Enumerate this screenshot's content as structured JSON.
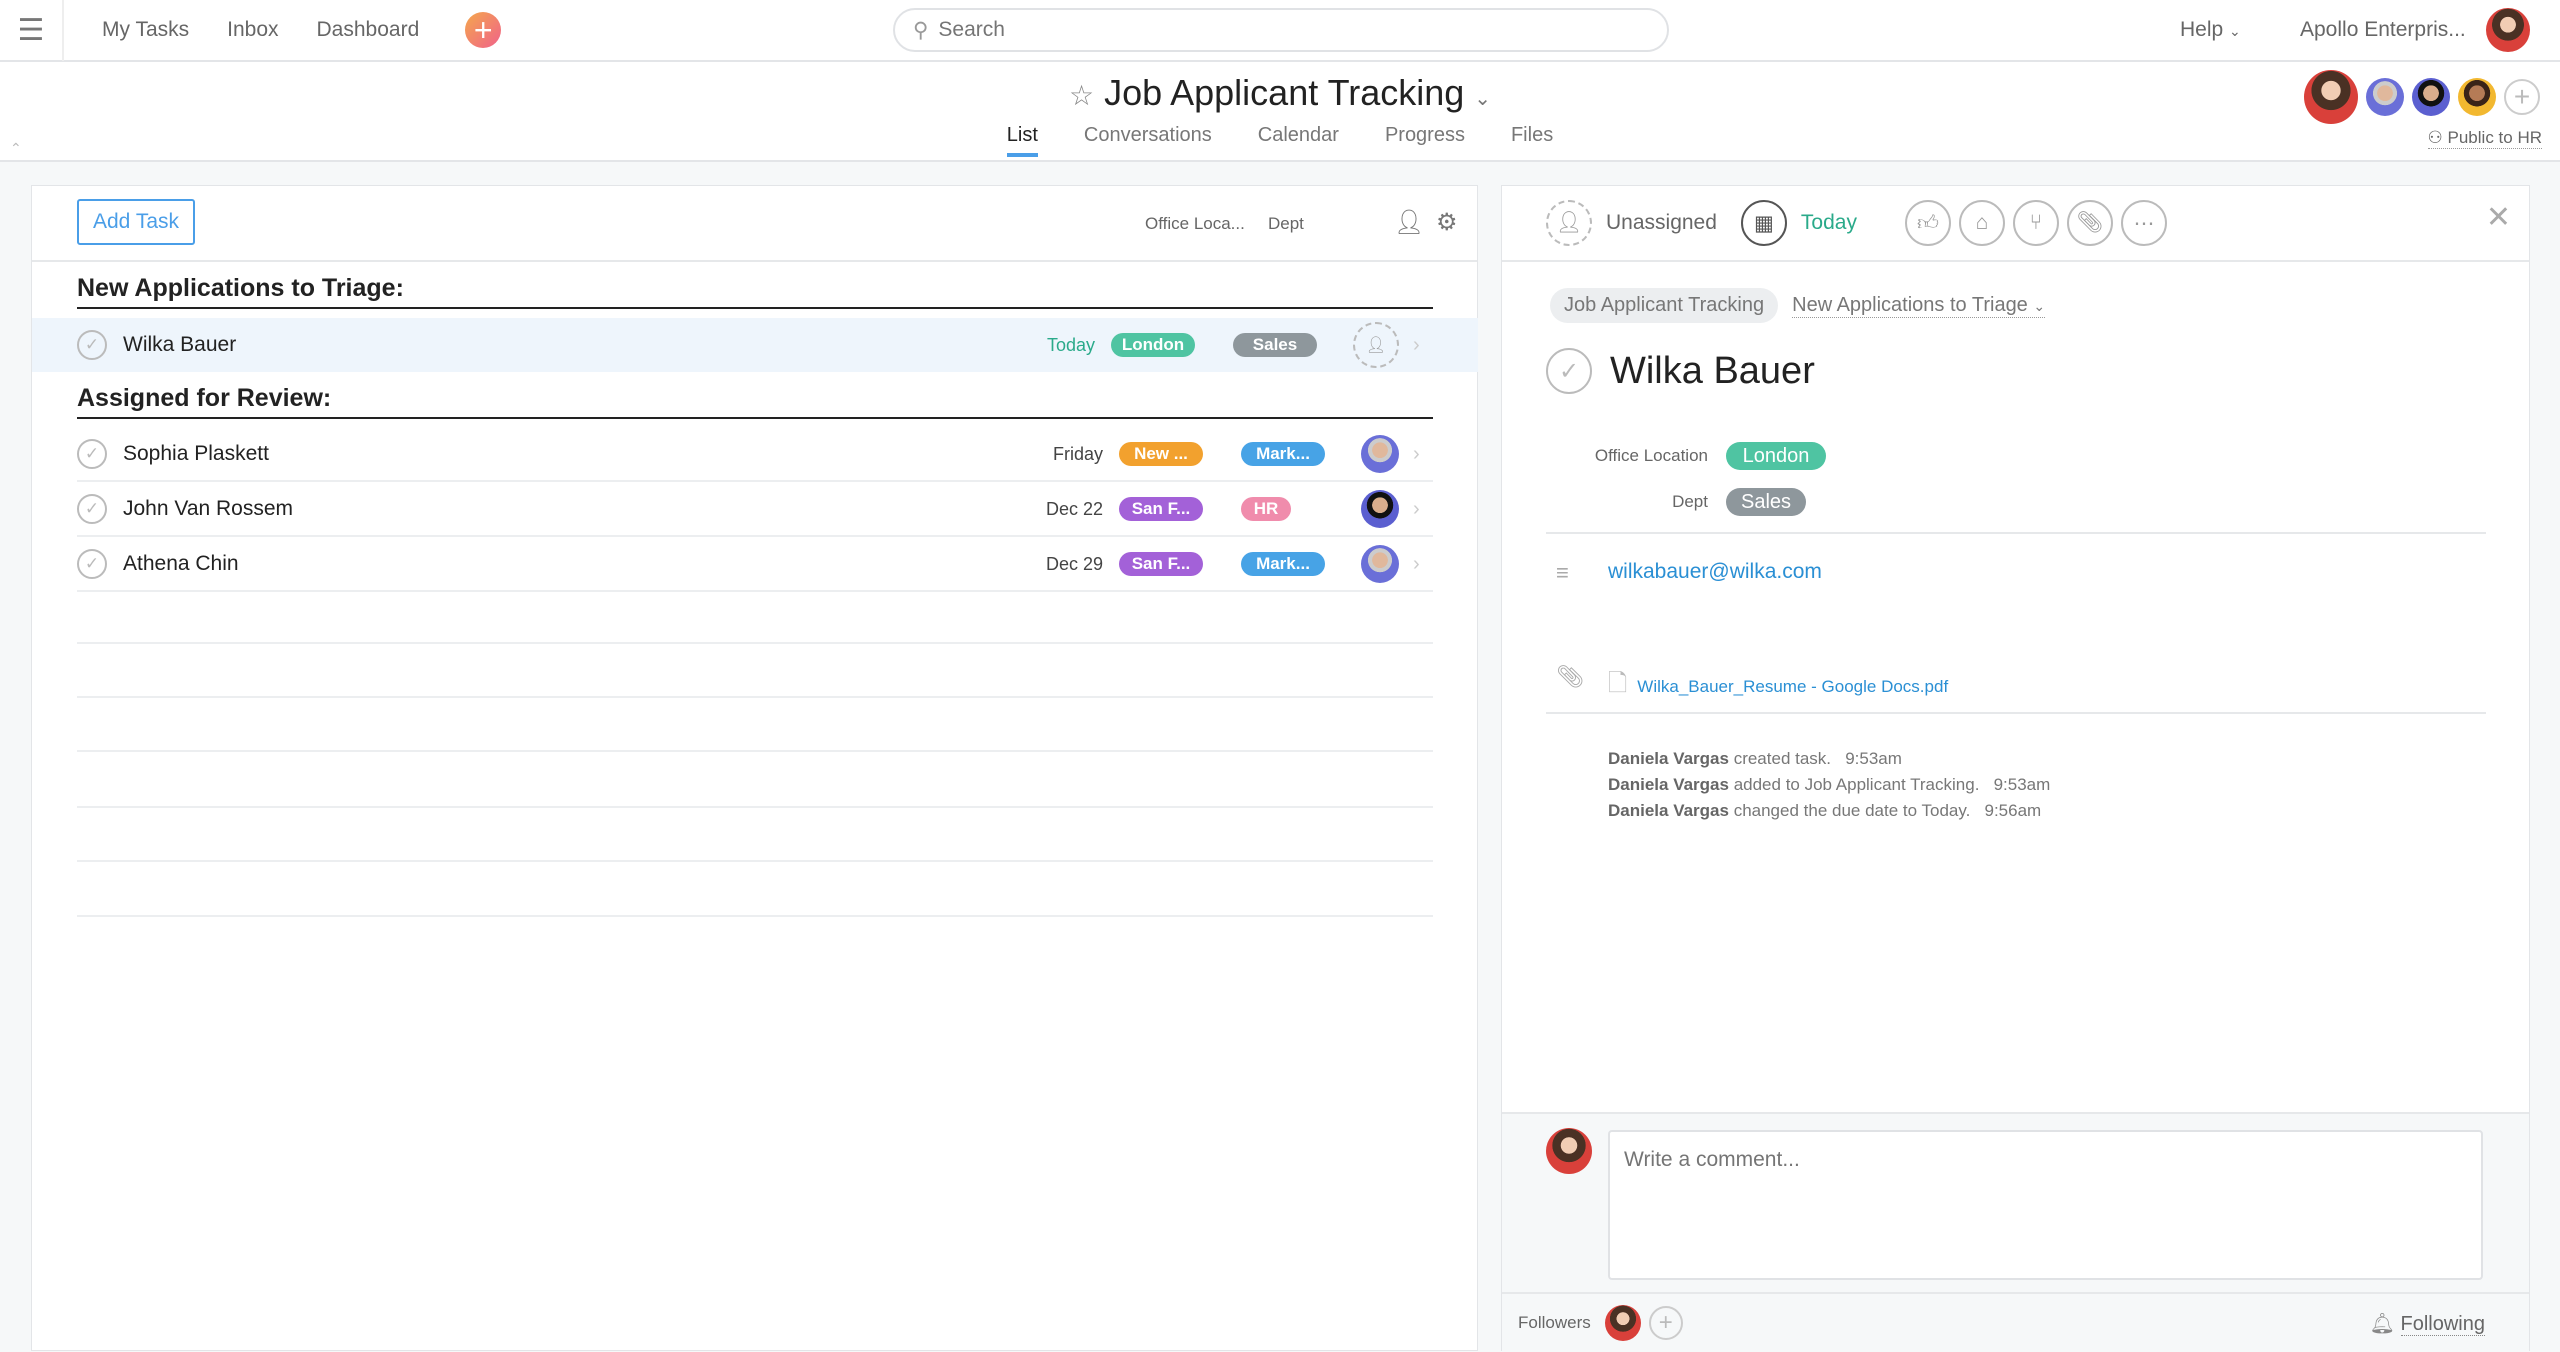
{
  "topbar": {
    "nav": [
      "My Tasks",
      "Inbox",
      "Dashboard"
    ],
    "search_placeholder": "Search",
    "help": "Help",
    "org": "Apollo Enterpris..."
  },
  "project": {
    "title": "Job Applicant Tracking",
    "tabs": [
      "List",
      "Conversations",
      "Calendar",
      "Progress",
      "Files"
    ],
    "active_tab": "List",
    "visibility": "Public to HR"
  },
  "list": {
    "add_task": "Add Task",
    "columns": [
      "Office Loca...",
      "Dept"
    ],
    "sections": [
      {
        "title": "New Applications to Triage:",
        "tasks": [
          {
            "name": "Wilka Bauer",
            "due": "Today",
            "location": "London",
            "location_color": "#4fc4a2",
            "dept": "Sales",
            "dept_color": "#8e979c",
            "assignee": "unassigned"
          }
        ]
      },
      {
        "title": "Assigned for Review:",
        "tasks": [
          {
            "name": "Sophia Plaskett",
            "due": "Friday",
            "location": "New ...",
            "location_color": "#f2a12e",
            "dept": "Mark...",
            "dept_color": "#47a3e6",
            "assignee": "b"
          },
          {
            "name": "John Van Rossem",
            "due": "Dec 22",
            "location": "San F...",
            "location_color": "#a361d8",
            "dept": "HR",
            "dept_color": "#f08cac",
            "assignee": "c"
          },
          {
            "name": "Athena Chin",
            "due": "Dec 29",
            "location": "San F...",
            "location_color": "#a361d8",
            "dept": "Mark...",
            "dept_color": "#47a3e6",
            "assignee": "b"
          }
        ]
      }
    ]
  },
  "detail": {
    "assignee": "Unassigned",
    "due": "Today",
    "project": "Job Applicant Tracking",
    "section": "New Applications to Triage",
    "title": "Wilka Bauer",
    "fields": [
      {
        "label": "Office Location",
        "value": "London",
        "color": "#4fc4a2"
      },
      {
        "label": "Dept",
        "value": "Sales",
        "color": "#8e979c"
      }
    ],
    "description": "wilkabauer@wilka.com",
    "attachment": "Wilka_Bauer_Resume - Google Docs.pdf",
    "activity": [
      {
        "who": "Daniela Vargas",
        "what": " created task.",
        "time": "9:53am"
      },
      {
        "who": "Daniela Vargas",
        "what": " added to Job Applicant Tracking.",
        "time": "9:53am"
      },
      {
        "who": "Daniela Vargas",
        "what": " changed the due date to Today.",
        "time": "9:56am"
      }
    ],
    "comment_placeholder": "Write a comment...",
    "followers_label": "Followers",
    "following": "Following"
  }
}
